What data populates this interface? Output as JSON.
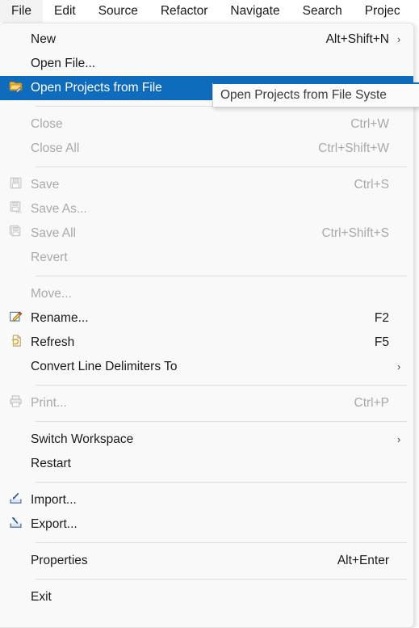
{
  "menubar": {
    "items": [
      {
        "label": "File",
        "active": true
      },
      {
        "label": "Edit",
        "active": false
      },
      {
        "label": "Source",
        "active": false
      },
      {
        "label": "Refactor",
        "active": false
      },
      {
        "label": "Navigate",
        "active": false
      },
      {
        "label": "Search",
        "active": false
      },
      {
        "label": "Projec",
        "active": false
      }
    ]
  },
  "colors": {
    "highlight": "#0f6cbd",
    "menu_background": "#f9f9f9",
    "text": "#1a1a1a",
    "disabled_text": "#a9a9a9",
    "separator": "#dcdcdc",
    "tooltip_accent": "#0f6cbd"
  },
  "file_menu": {
    "groups": [
      {
        "items": [
          {
            "label": "New",
            "accel": "Alt+Shift+N",
            "arrow": "›",
            "icon": "",
            "disabled": false,
            "selected": false
          },
          {
            "label": "Open File...",
            "accel": "",
            "arrow": "",
            "icon": "",
            "disabled": false,
            "selected": false
          },
          {
            "label": "Open Projects from File",
            "accel": "",
            "arrow": "",
            "icon": "open-projects-folder-icon",
            "disabled": false,
            "selected": true
          }
        ]
      },
      {
        "items": [
          {
            "label": "Close",
            "accel": "Ctrl+W",
            "arrow": "",
            "icon": "",
            "disabled": true,
            "selected": false
          },
          {
            "label": "Close All",
            "accel": "Ctrl+Shift+W",
            "arrow": "",
            "icon": "",
            "disabled": true,
            "selected": false
          }
        ]
      },
      {
        "items": [
          {
            "label": "Save",
            "accel": "Ctrl+S",
            "arrow": "",
            "icon": "save-floppy-icon",
            "disabled": true,
            "selected": false
          },
          {
            "label": "Save As...",
            "accel": "",
            "arrow": "",
            "icon": "save-as-floppy-icon",
            "disabled": true,
            "selected": false
          },
          {
            "label": "Save All",
            "accel": "Ctrl+Shift+S",
            "arrow": "",
            "icon": "save-all-floppy-icon",
            "disabled": true,
            "selected": false
          },
          {
            "label": "Revert",
            "accel": "",
            "arrow": "",
            "icon": "",
            "disabled": true,
            "selected": false
          }
        ]
      },
      {
        "items": [
          {
            "label": "Move...",
            "accel": "",
            "arrow": "",
            "icon": "",
            "disabled": true,
            "selected": false
          },
          {
            "label": "Rename...",
            "accel": "F2",
            "arrow": "",
            "icon": "rename-pencil-icon",
            "disabled": false,
            "selected": false
          },
          {
            "label": "Refresh",
            "accel": "F5",
            "arrow": "",
            "icon": "refresh-page-icon",
            "disabled": false,
            "selected": false
          },
          {
            "label": "Convert Line Delimiters To",
            "accel": "",
            "arrow": "›",
            "icon": "",
            "disabled": false,
            "selected": false
          }
        ]
      },
      {
        "items": [
          {
            "label": "Print...",
            "accel": "Ctrl+P",
            "arrow": "",
            "icon": "print-printer-icon",
            "disabled": true,
            "selected": false
          }
        ]
      },
      {
        "items": [
          {
            "label": "Switch Workspace",
            "accel": "",
            "arrow": "›",
            "icon": "",
            "disabled": false,
            "selected": false
          },
          {
            "label": "Restart",
            "accel": "",
            "arrow": "",
            "icon": "",
            "disabled": false,
            "selected": false
          }
        ]
      },
      {
        "items": [
          {
            "label": "Import...",
            "accel": "",
            "arrow": "",
            "icon": "import-tray-icon",
            "disabled": false,
            "selected": false
          },
          {
            "label": "Export...",
            "accel": "",
            "arrow": "",
            "icon": "export-tray-icon",
            "disabled": false,
            "selected": false
          }
        ]
      },
      {
        "items": [
          {
            "label": "Properties",
            "accel": "Alt+Enter",
            "arrow": "",
            "icon": "",
            "disabled": false,
            "selected": false
          }
        ]
      },
      {
        "items": [
          {
            "label": "Exit",
            "accel": "",
            "arrow": "",
            "icon": "",
            "disabled": false,
            "selected": false
          }
        ]
      }
    ]
  },
  "tooltip": {
    "text": "Open Projects from File Syste"
  }
}
